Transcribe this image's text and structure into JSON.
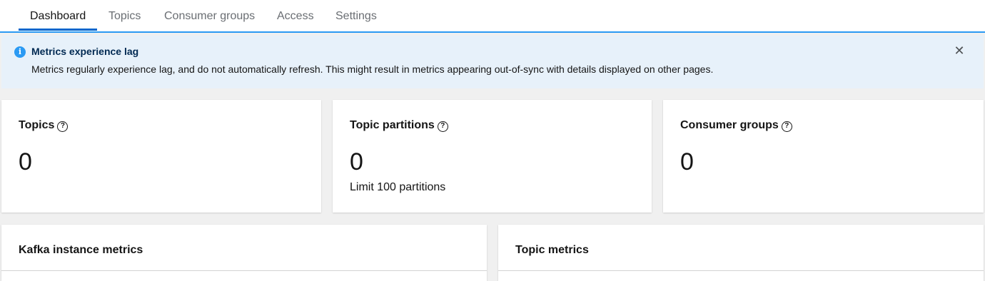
{
  "tabs": [
    {
      "label": "Dashboard",
      "active": true
    },
    {
      "label": "Topics"
    },
    {
      "label": "Consumer groups"
    },
    {
      "label": "Access"
    },
    {
      "label": "Settings"
    }
  ],
  "alert": {
    "icon": "info-icon",
    "title": "Metrics experience lag",
    "body": "Metrics regularly experience lag, and do not automatically refresh. This might result in metrics appearing out-of-sync with details displayed on other pages.",
    "close_icon": "close-icon"
  },
  "cards": {
    "topics": {
      "title": "Topics",
      "value": "0"
    },
    "partitions": {
      "title": "Topic partitions",
      "value": "0",
      "sub": "Limit 100 partitions"
    },
    "consumer_groups": {
      "title": "Consumer groups",
      "value": "0"
    }
  },
  "panels": {
    "kafka": {
      "title": "Kafka instance metrics"
    },
    "topic": {
      "title": "Topic metrics"
    }
  },
  "colors": {
    "accent": "#0066cc",
    "tab_border": "#2b9af3",
    "alert_bg": "#e7f1fa",
    "alert_title": "#002952"
  }
}
